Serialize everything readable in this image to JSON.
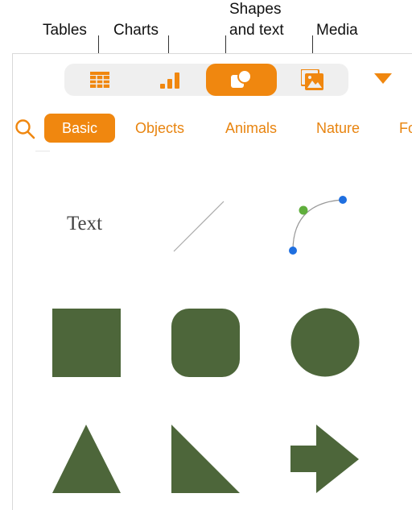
{
  "callouts": {
    "tables": "Tables",
    "charts": "Charts",
    "shapes_line1": "Shapes",
    "shapes_line2": "and text",
    "media": "Media"
  },
  "toolbar": {
    "segments": [
      "tables-icon",
      "charts-icon",
      "shapes-icon",
      "media-icon"
    ],
    "active_segment": "shapes-icon",
    "accent_color": "#f0870f"
  },
  "categories": {
    "items": [
      "Basic",
      "Objects",
      "Animals",
      "Nature",
      "Fo"
    ],
    "selected": "Basic"
  },
  "shapes": {
    "text_label": "Text",
    "fill_color": "#4d663a",
    "items": [
      "text",
      "line",
      "curve",
      "square",
      "rounded-square",
      "circle",
      "triangle",
      "right-triangle",
      "arrow"
    ]
  }
}
